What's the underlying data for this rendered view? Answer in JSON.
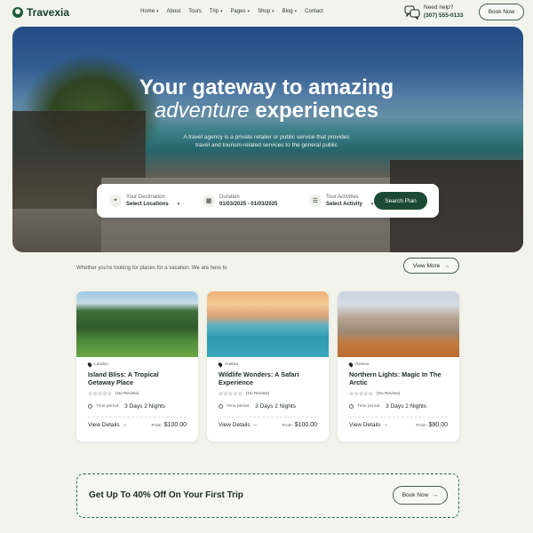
{
  "brand": {
    "name": "Travexia",
    "accent": "#1c4a33"
  },
  "nav": [
    {
      "label": "Home",
      "dropdown": true
    },
    {
      "label": "About",
      "dropdown": false
    },
    {
      "label": "Tours",
      "dropdown": false
    },
    {
      "label": "Trip",
      "dropdown": true
    },
    {
      "label": "Pages",
      "dropdown": true
    },
    {
      "label": "Shop",
      "dropdown": true
    },
    {
      "label": "Blog",
      "dropdown": true
    },
    {
      "label": "Contact",
      "dropdown": false
    }
  ],
  "help": {
    "label": "Need help?",
    "phone": "(307) 555-0133"
  },
  "header_button": "Book Now",
  "hero": {
    "title_line1": "Your gateway to amazing",
    "title_em": "adventure",
    "title_line2_rest": " experiences",
    "subtitle_line1": "A travel agency is a private retailer or public service that provides",
    "subtitle_line2": "travel and tourism-related services to the general public"
  },
  "search": {
    "destination": {
      "label": "Your Destination",
      "value": "Select Locations"
    },
    "duration": {
      "label": "Duration",
      "value": "01/03/2025 - 01/03/2025"
    },
    "activities": {
      "label": "Tour Activities",
      "value": "Select Activity"
    },
    "button": "Search Plan"
  },
  "section_note": "Whether you're looking for places for a vacation. We are here to",
  "view_more": "View More",
  "cards": [
    {
      "location": "London",
      "title": "Island Bliss: A Tropical Getaway Place",
      "rating_text": "(No Review)",
      "time_label": "Time period",
      "time_value": "3 Days 2 Nights",
      "details": "View Details",
      "price_label": "From",
      "price": "$100.00"
    },
    {
      "location": "Austria",
      "title": "Wildlife Wonders: A Safari Experience",
      "rating_text": "(No Review)",
      "time_label": "Time period",
      "time_value": "3 Days 2 Nights",
      "details": "View Details",
      "price_label": "From",
      "price": "$100.00"
    },
    {
      "location": "Greece",
      "title": "Northern Lights: Magic In The Arctic",
      "rating_text": "(No Review)",
      "time_label": "Time period",
      "time_value": "3 Days 2 Nights",
      "details": "View Details",
      "price_label": "From",
      "price": "$90.00"
    }
  ],
  "promo": {
    "text": "Get Up To 40% Off On Your First Trip",
    "button": "Book Now"
  }
}
